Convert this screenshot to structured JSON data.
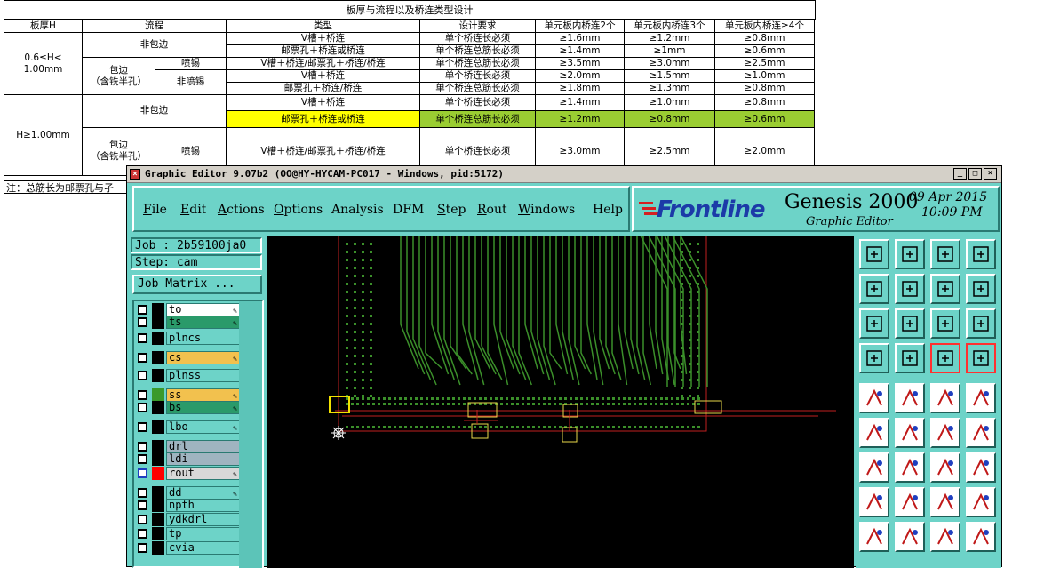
{
  "sheet": {
    "title": "板厚与流程以及桥连类型设计",
    "headers": [
      "板厚H",
      "流程",
      "类型",
      "设计要求",
      "单元板内桥连2个",
      "单元板内桥连3个",
      "单元板内桥连≥4个"
    ],
    "range1": "0.6≤H<\n1.00mm",
    "range2": "H≥1.00mm",
    "non_wrap": "非包边",
    "wrap": "包边\n（含铣半孔）",
    "spray": "喷锡",
    "non_spray": "非喷锡",
    "rows": [
      [
        "V槽＋桥连",
        "单个桥连长必须",
        "≥1.6mm",
        "≥1.2mm",
        "≥0.8mm"
      ],
      [
        "邮票孔＋桥连或桥连",
        "单个桥连总筋长必须",
        "≥1.4mm",
        "≥1mm",
        "≥0.6mm"
      ],
      [
        "V槽＋桥连/邮票孔＋桥连/桥连",
        "单个桥连总筋长必须",
        "≥3.5mm",
        "≥3.0mm",
        "≥2.5mm"
      ],
      [
        "V槽＋桥连",
        "单个桥连长必须",
        "≥2.0mm",
        "≥1.5mm",
        "≥1.0mm"
      ],
      [
        "邮票孔＋桥连/桥连",
        "单个桥连总筋长必须",
        "≥1.8mm",
        "≥1.3mm",
        "≥0.8mm"
      ],
      [
        "V槽＋桥连",
        "单个桥连长必须",
        "≥1.4mm",
        "≥1.0mm",
        "≥0.8mm"
      ],
      [
        "邮票孔＋桥连或桥连",
        "单个桥连总筋长必须",
        "≥1.2mm",
        "≥0.8mm",
        "≥0.6mm"
      ],
      [
        "V槽＋桥连/邮票孔＋桥连/桥连",
        "单个桥连长必须",
        "≥3.0mm",
        "≥2.5mm",
        "≥2.0mm"
      ]
    ],
    "note": "注：总筋长为邮票孔与孑"
  },
  "window": {
    "title": "Graphic Editor 9.07b2 (OO@HY-HYCAM-PC017 - Windows, pid:5172)",
    "min": "_",
    "max": "□",
    "close": "×"
  },
  "menu": {
    "file": {
      "u": "F",
      "rest": "ile"
    },
    "edit": {
      "u": "E",
      "rest": "dit"
    },
    "actions": {
      "u": "A",
      "rest": "ctions"
    },
    "options": {
      "u": "O",
      "rest": "ptions"
    },
    "analysis": {
      "u": "",
      "rest": "Analysis"
    },
    "dfm": {
      "u": "",
      "rest": "DFM"
    },
    "step": {
      "u": "S",
      "rest": "tep"
    },
    "rout": {
      "u": "R",
      "rest": "out"
    },
    "windows": {
      "u": "W",
      "rest": "indows"
    },
    "help": {
      "u": "",
      "rest": "Help"
    }
  },
  "brand": {
    "logo": "Frontline",
    "product": "Genesis 2000",
    "subtitle": "Graphic Editor",
    "date": "09 Apr 2015",
    "time": "10:09 PM"
  },
  "job": {
    "job_label": "Job : 2b59100ja0",
    "step_label": "Step: cam",
    "matrix_button": "Job Matrix ..."
  },
  "layers": [
    {
      "name": "to",
      "color": "#ffffff",
      "swatch": "#000000",
      "checked": false,
      "pen": true
    },
    {
      "name": "ts",
      "color": "#2a9a6a",
      "swatch": "#000000",
      "checked": false,
      "pen": true
    },
    {
      "name": "plncs",
      "color": "#6dd3c8",
      "swatch": "#000000",
      "checked": false,
      "pen": false
    },
    {
      "name": "cs",
      "color": "#f2c14e",
      "swatch": "#000000",
      "checked": false,
      "pen": true
    },
    {
      "name": "plnss",
      "color": "#6dd3c8",
      "swatch": "#000000",
      "checked": false,
      "pen": false
    },
    {
      "name": "ss",
      "color": "#f2c14e",
      "swatch": "#3a9a2a",
      "checked": false,
      "pen": true
    },
    {
      "name": "bs",
      "color": "#2a9a6a",
      "swatch": "#000000",
      "checked": false,
      "pen": true
    },
    {
      "name": "lbo",
      "color": "#6dd3c8",
      "swatch": "#000000",
      "checked": false,
      "pen": true
    },
    {
      "name": "drl",
      "color": "#9fb4c0",
      "swatch": "#000000",
      "checked": false,
      "pen": false
    },
    {
      "name": "ldi",
      "color": "#9fb4c0",
      "swatch": "#000000",
      "checked": false,
      "pen": false
    },
    {
      "name": "rout",
      "color": "#d8d8d8",
      "swatch": "#ff0000",
      "checked": true,
      "pen": true
    },
    {
      "name": "dd",
      "color": "#6dd3c8",
      "swatch": "#000000",
      "checked": false,
      "pen": true
    },
    {
      "name": "npth",
      "color": "#6dd3c8",
      "swatch": "#000000",
      "checked": false,
      "pen": false
    },
    {
      "name": "ydkdrl",
      "color": "#6dd3c8",
      "swatch": "#000000",
      "checked": false,
      "pen": false
    },
    {
      "name": "tp",
      "color": "#6dd3c8",
      "swatch": "#000000",
      "checked": false,
      "pen": false
    },
    {
      "name": "cvia",
      "color": "#6dd3c8",
      "swatch": "#000000",
      "checked": false,
      "pen": false
    }
  ],
  "tool_icons": [
    "zoom-home-icon",
    "zoom-in-icon",
    "home-icon",
    "window-fit-icon",
    "pan-left-icon",
    "pan-right-icon",
    "undo-zoom-icon",
    "redraw-icon",
    "zoom-fit-icon",
    "zoom-center-icon",
    "ratio-icon",
    "help-icon",
    "measure-icon",
    "snap-icon",
    "traffic-light-icon",
    "traffic-light-active-icon",
    "select-icon",
    "cut-icon",
    "ruler-icon",
    "pad-icon",
    "connect-icon",
    "delete-icon",
    "move-icon",
    "copy-icon",
    "line-icon",
    "slant-icon",
    "rotate-icon",
    "mirror-icon",
    "pad-add-icon",
    "break-icon",
    "distance-icon",
    "group-icon",
    "arc-icon",
    "arc-pair-icon",
    "arc-step-icon",
    "arc-rule-icon"
  ]
}
